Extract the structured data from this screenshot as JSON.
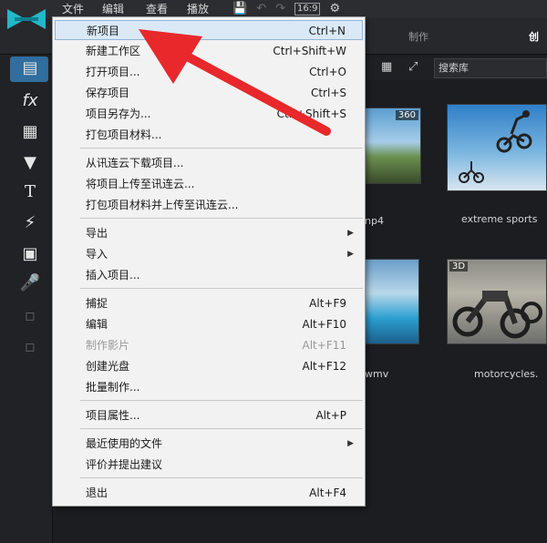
{
  "menubar": {
    "file": "文件",
    "edit": "编辑",
    "view": "查看",
    "play": "播放",
    "aspect": "16:9"
  },
  "tabs": {
    "produce": "制作",
    "create": "创"
  },
  "library": {
    "search_placeholder": "搜索库"
  },
  "media": [
    {
      "label": "np4",
      "badge": "360"
    },
    {
      "label": "extreme sports",
      "badge": ""
    },
    {
      "label": "wmv",
      "badge": ""
    },
    {
      "label": "motorcycles.",
      "badge": "3D"
    }
  ],
  "file_menu": {
    "items": [
      {
        "label": "新项目",
        "shortcut": "Ctrl+N"
      },
      {
        "label": "新建工作区",
        "shortcut": "Ctrl+Shift+W"
      },
      {
        "label": "打开项目...",
        "shortcut": "Ctrl+O"
      },
      {
        "label": "保存项目",
        "shortcut": "Ctrl+S"
      },
      {
        "label": "项目另存为...",
        "shortcut": "Ctrl+Shift+S"
      },
      {
        "label": "打包项目材料...",
        "shortcut": ""
      },
      {
        "label": "从讯连云下载项目...",
        "shortcut": ""
      },
      {
        "label": "将项目上传至讯连云...",
        "shortcut": ""
      },
      {
        "label": "打包项目材料并上传至讯连云...",
        "shortcut": ""
      },
      {
        "label": "导出",
        "shortcut": ""
      },
      {
        "label": "导入",
        "shortcut": ""
      },
      {
        "label": "插入项目...",
        "shortcut": ""
      },
      {
        "label": "捕捉",
        "shortcut": "Alt+F9"
      },
      {
        "label": "编辑",
        "shortcut": "Alt+F10"
      },
      {
        "label": "制作影片",
        "shortcut": "Alt+F11"
      },
      {
        "label": "创建光盘",
        "shortcut": "Alt+F12"
      },
      {
        "label": "批量制作...",
        "shortcut": ""
      },
      {
        "label": "项目属性...",
        "shortcut": "Alt+P"
      },
      {
        "label": "最近使用的文件",
        "shortcut": ""
      },
      {
        "label": "评价并提出建议",
        "shortcut": ""
      },
      {
        "label": "退出",
        "shortcut": "Alt+F4"
      }
    ]
  },
  "colors": {
    "accent": "#2f6e9e",
    "arrow": "#e8282b",
    "menu_bg": "#f2f2f2"
  }
}
